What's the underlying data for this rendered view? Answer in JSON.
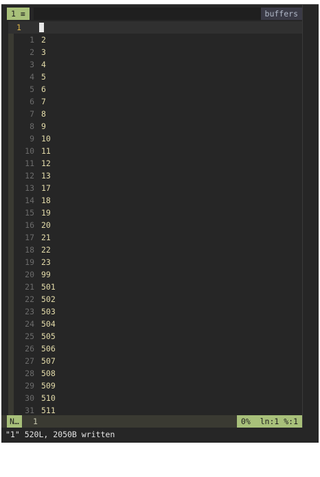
{
  "tabline": {
    "active_tab_label": "1 ≡",
    "buffers_label": "buffers"
  },
  "editor": {
    "cursor_line_number": "1",
    "cursor_line_text": "",
    "lines": [
      {
        "rel": "1",
        "text": "2"
      },
      {
        "rel": "2",
        "text": "3"
      },
      {
        "rel": "3",
        "text": "4"
      },
      {
        "rel": "4",
        "text": "5"
      },
      {
        "rel": "5",
        "text": "6"
      },
      {
        "rel": "6",
        "text": "7"
      },
      {
        "rel": "7",
        "text": "8"
      },
      {
        "rel": "8",
        "text": "9"
      },
      {
        "rel": "9",
        "text": "10"
      },
      {
        "rel": "10",
        "text": "11"
      },
      {
        "rel": "11",
        "text": "12"
      },
      {
        "rel": "12",
        "text": "13"
      },
      {
        "rel": "13",
        "text": "17"
      },
      {
        "rel": "14",
        "text": "18"
      },
      {
        "rel": "15",
        "text": "19"
      },
      {
        "rel": "16",
        "text": "20"
      },
      {
        "rel": "17",
        "text": "21"
      },
      {
        "rel": "18",
        "text": "22"
      },
      {
        "rel": "19",
        "text": "23"
      },
      {
        "rel": "20",
        "text": "99"
      },
      {
        "rel": "21",
        "text": "501"
      },
      {
        "rel": "22",
        "text": "502"
      },
      {
        "rel": "23",
        "text": "503"
      },
      {
        "rel": "24",
        "text": "504"
      },
      {
        "rel": "25",
        "text": "505"
      },
      {
        "rel": "26",
        "text": "506"
      },
      {
        "rel": "27",
        "text": "507"
      },
      {
        "rel": "28",
        "text": "508"
      },
      {
        "rel": "29",
        "text": "509"
      },
      {
        "rel": "30",
        "text": "510"
      },
      {
        "rel": "31",
        "text": "511"
      }
    ]
  },
  "statusline": {
    "mode": "N…",
    "buffer_number": "1",
    "position": "0%  ln:1 %:1"
  },
  "message": "\"1\" 520L, 2050B written",
  "colors": {
    "accent_green": "#a8c07a",
    "background": "#262626",
    "text": "#e4dcaa",
    "line_number": "#6c6c6c",
    "cursor_line_number": "#e0b84a"
  }
}
